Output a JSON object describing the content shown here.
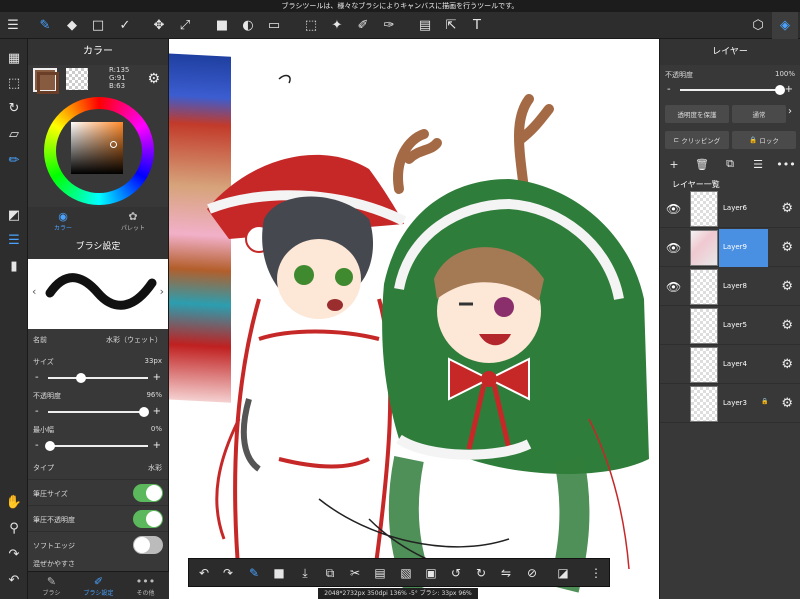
{
  "status_hint": "ブラシツールは、様々なブラシによりキャンバスに描画を行うツールです。",
  "left_panel": {
    "color_title": "カラー",
    "rgb": {
      "r": "R:135",
      "g": "G:91",
      "b": "B:63"
    },
    "color_tabs": [
      {
        "label": "カラー"
      },
      {
        "label": "パレット"
      }
    ],
    "brush_title": "ブラシ設定",
    "brush_name_label": "名前",
    "brush_name_value": "水彩（ウェット）",
    "size": {
      "label": "サイズ",
      "value": "33px",
      "fraction": 0.33
    },
    "opacity": {
      "label": "不透明度",
      "value": "96%",
      "fraction": 0.96
    },
    "min_width": {
      "label": "最小幅",
      "value": "0%",
      "fraction": 0.0
    },
    "type": {
      "label": "タイプ",
      "value": "水彩"
    },
    "toggles": [
      {
        "label": "筆圧サイズ",
        "on": true
      },
      {
        "label": "筆圧不透明度",
        "on": true
      },
      {
        "label": "ソフトエッジ",
        "on": false
      }
    ],
    "cut_off_label": "混ぜかやすさ",
    "bottom_tabs": [
      {
        "label": "ブラシ"
      },
      {
        "label": "ブラシ設定"
      },
      {
        "label": "その他"
      }
    ]
  },
  "right_panel": {
    "title": "レイヤー",
    "opacity_label": "不透明度",
    "opacity_value": "100%",
    "protect_label": "透明度を保護",
    "blend_label": "通常",
    "clipping_label": "クリッピング",
    "lock_label": "ロック",
    "layer_list_title": "レイヤー一覧",
    "layers": [
      {
        "name": "Layer6",
        "selected": false,
        "visible": true,
        "locked": false
      },
      {
        "name": "Layer9",
        "selected": true,
        "visible": true,
        "locked": false
      },
      {
        "name": "Layer8",
        "selected": false,
        "visible": true,
        "locked": false
      },
      {
        "name": "Layer5",
        "selected": false,
        "visible": false,
        "locked": false
      },
      {
        "name": "Layer4",
        "selected": false,
        "visible": false,
        "locked": false
      },
      {
        "name": "Layer3",
        "selected": false,
        "visible": false,
        "locked": true
      }
    ]
  },
  "canvas_readout": "2048*2732px 350dpi 136% -5° ブラシ: 33px 96%",
  "colors": {
    "accent": "#4aa3ff",
    "main_color": "#875b3f",
    "selected_layer": "#4a90e2",
    "toggle_on": "#5cb85c"
  }
}
